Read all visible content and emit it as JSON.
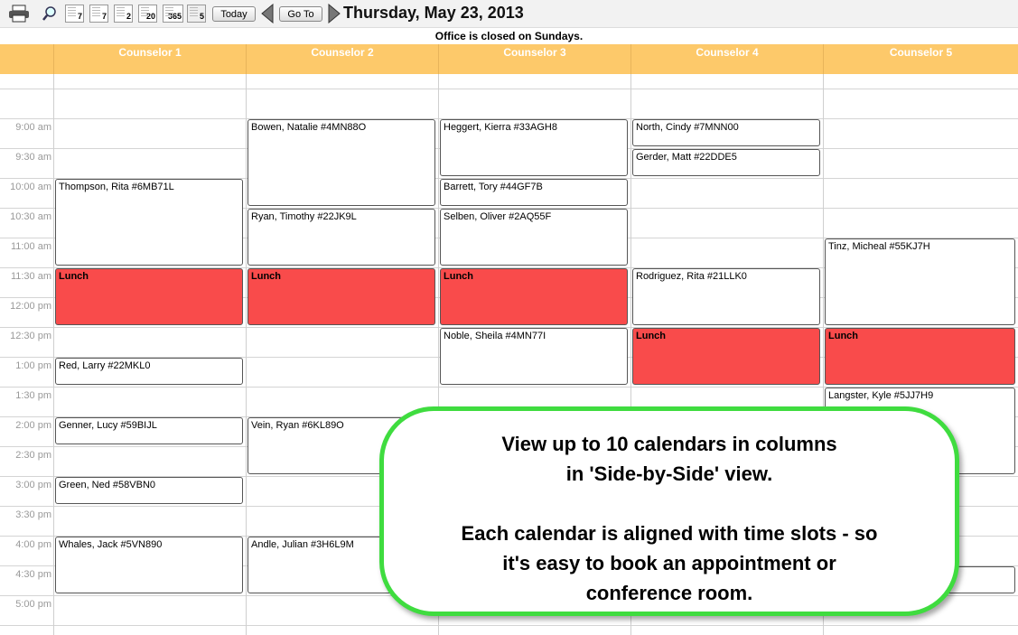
{
  "toolbar": {
    "print_icon": "printer-icon",
    "search_icon": "magnifier-icon",
    "view_icons": [
      "7",
      "7",
      "2",
      "20",
      "365",
      "5"
    ],
    "today_label": "Today",
    "goto_label": "Go To",
    "date_title": "Thursday, May 23, 2013"
  },
  "notice": "Office is closed on Sundays.",
  "columns": [
    "Counselor 1",
    "Counselor 2",
    "Counselor 3",
    "Counselor 4",
    "Counselor 5"
  ],
  "times": [
    "9:00 am",
    "9:30 am",
    "10:00 am",
    "10:30 am",
    "11:00 am",
    "11:30 am",
    "12:00 pm",
    "12:30 pm",
    "1:00 pm",
    "1:30 pm",
    "2:00 pm",
    "2:30 pm",
    "3:00 pm",
    "3:30 pm",
    "4:00 pm",
    "4:30 pm",
    "5:00 pm"
  ],
  "appointments": [
    {
      "col": 1,
      "start": "10:00 am",
      "end": "11:30 am",
      "text": "Thompson, Rita #6MB71L",
      "lunch": false
    },
    {
      "col": 1,
      "start": "11:30 am",
      "end": "12:30 pm",
      "text": "Lunch",
      "lunch": true
    },
    {
      "col": 1,
      "start": "1:00 pm",
      "end": "1:30 pm",
      "text": "Red, Larry #22MKL0",
      "lunch": false
    },
    {
      "col": 1,
      "start": "2:00 pm",
      "end": "2:30 pm",
      "text": "Genner, Lucy #59BIJL",
      "lunch": false
    },
    {
      "col": 1,
      "start": "3:00 pm",
      "end": "3:30 pm",
      "text": "Green, Ned #58VBN0",
      "lunch": false
    },
    {
      "col": 1,
      "start": "4:00 pm",
      "end": "5:00 pm",
      "text": "Whales, Jack #5VN890",
      "lunch": false
    },
    {
      "col": 2,
      "start": "9:00 am",
      "end": "10:30 am",
      "text": "Bowen, Natalie #4MN88O",
      "lunch": false
    },
    {
      "col": 2,
      "start": "10:30 am",
      "end": "11:30 am",
      "text": "Ryan, Timothy #22JK9L",
      "lunch": false
    },
    {
      "col": 2,
      "start": "11:30 am",
      "end": "12:30 pm",
      "text": "Lunch",
      "lunch": true
    },
    {
      "col": 2,
      "start": "2:00 pm",
      "end": "3:00 pm",
      "text": "Vein, Ryan #6KL89O",
      "lunch": false
    },
    {
      "col": 2,
      "start": "4:00 pm",
      "end": "5:00 pm",
      "text": "Andle, Julian #3H6L9M",
      "lunch": false
    },
    {
      "col": 3,
      "start": "9:00 am",
      "end": "10:00 am",
      "text": "Heggert, Kierra #33AGH8",
      "lunch": false
    },
    {
      "col": 3,
      "start": "10:00 am",
      "end": "10:30 am",
      "text": "Barrett, Tory #44GF7B",
      "lunch": false
    },
    {
      "col": 3,
      "start": "10:30 am",
      "end": "11:30 am",
      "text": "Selben, Oliver #2AQ55F",
      "lunch": false
    },
    {
      "col": 3,
      "start": "11:30 am",
      "end": "12:30 pm",
      "text": "Lunch",
      "lunch": true
    },
    {
      "col": 3,
      "start": "12:30 pm",
      "end": "1:30 pm",
      "text": "Noble, Sheila #4MN77I",
      "lunch": false
    },
    {
      "col": 4,
      "start": "9:00 am",
      "end": "9:30 am",
      "text": "North, Cindy #7MNN00",
      "lunch": false
    },
    {
      "col": 4,
      "start": "9:30 am",
      "end": "10:00 am",
      "text": "Gerder, Matt #22DDE5",
      "lunch": false
    },
    {
      "col": 4,
      "start": "11:30 am",
      "end": "12:30 pm",
      "text": "Rodriguez, Rita #21LLK0",
      "lunch": false
    },
    {
      "col": 4,
      "start": "12:30 pm",
      "end": "1:30 pm",
      "text": "Lunch",
      "lunch": true
    },
    {
      "col": 5,
      "start": "11:00 am",
      "end": "12:30 pm",
      "text": "Tinz, Micheal #55KJ7H",
      "lunch": false
    },
    {
      "col": 5,
      "start": "12:30 pm",
      "end": "1:30 pm",
      "text": "Lunch",
      "lunch": true
    },
    {
      "col": 5,
      "start": "1:30 pm",
      "end": "3:00 pm",
      "text": "Langster, Kyle #5JJ7H9",
      "lunch": false
    },
    {
      "col": 5,
      "start": "4:30 pm",
      "end": "5:00 pm",
      "text": "",
      "lunch": false
    }
  ],
  "callout": {
    "line1": "View up to 10 calendars in columns",
    "line2": "in 'Side-by-Side' view.",
    "line3": "Each calendar is aligned with time slots - so",
    "line4": "it's easy to book an appointment or",
    "line5": "conference room."
  },
  "colors": {
    "header": "#fdc96a",
    "lunch": "#f94b4b",
    "callout_border": "#3fdc3f"
  }
}
